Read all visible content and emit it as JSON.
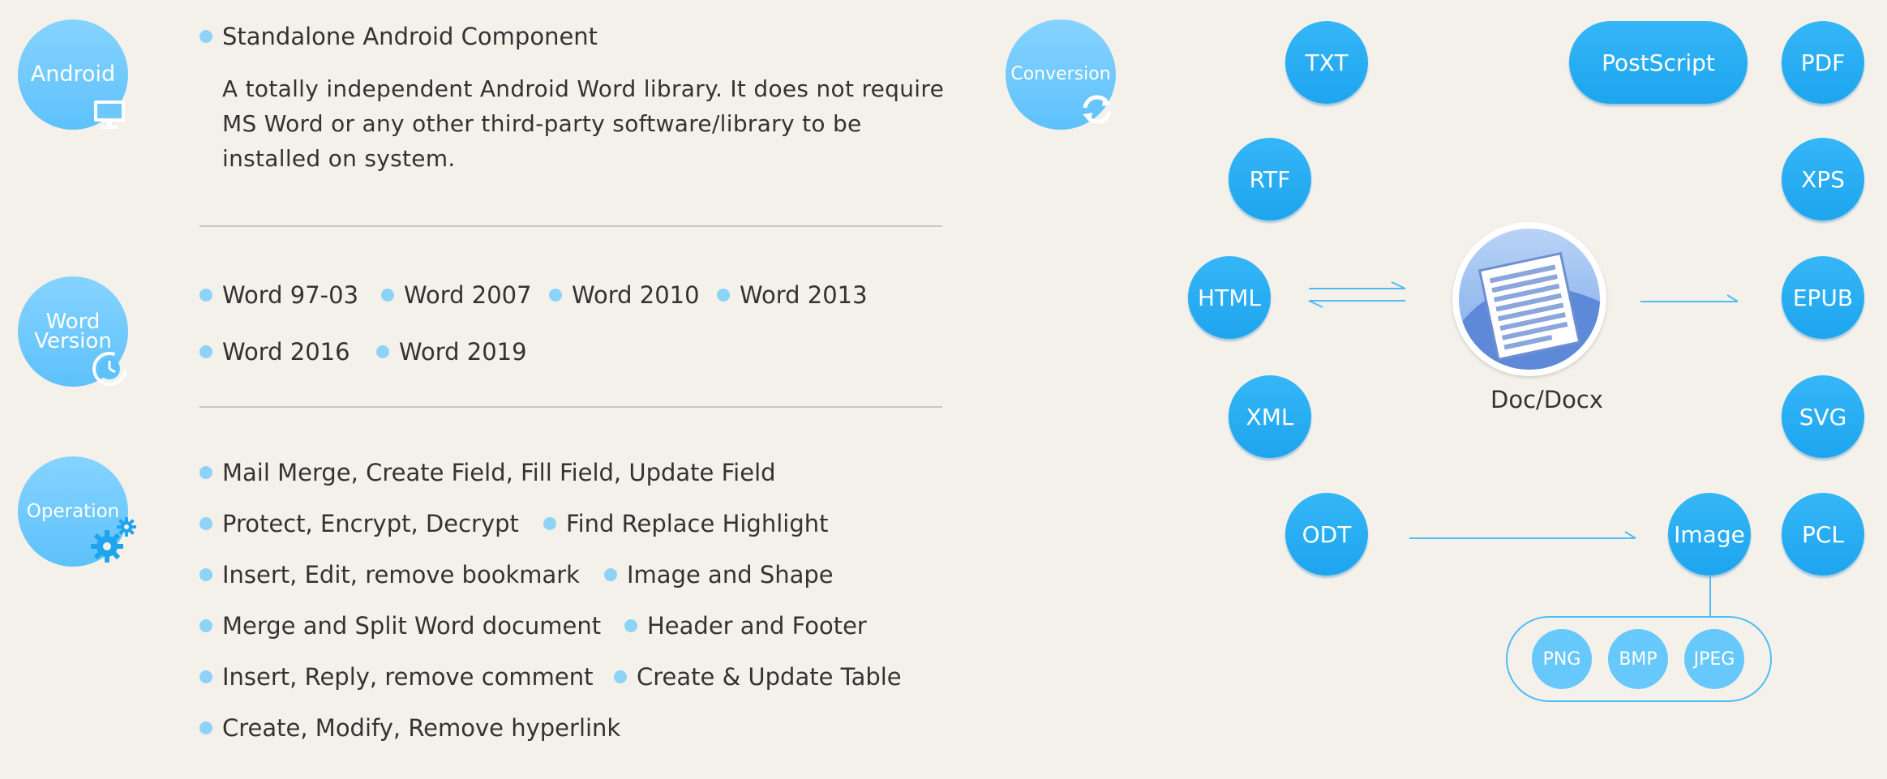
{
  "colors": {
    "background": "#f4f1eb",
    "badge": "#6ec8fc",
    "format_node": "#22a8ef",
    "bullet": "#8dd3f8",
    "arrow": "#4fbdf5",
    "text": "#333333"
  },
  "android": {
    "badge_label": "Android",
    "badge_icon": "monitor-icon",
    "title": "Standalone Android Component",
    "description": "A totally independent Android Word library. It does not require MS Word or any other third-party software/library to be installed on system."
  },
  "word_version": {
    "badge_label_line1": "Word",
    "badge_label_line2": "Version",
    "badge_icon": "clock-refresh-icon",
    "versions": [
      "Word 97-03",
      "Word 2007",
      "Word 2010",
      "Word 2013",
      "Word 2016",
      "Word 2019"
    ]
  },
  "operation": {
    "badge_label": "Operation",
    "badge_icon": "gears-icon",
    "items": [
      "Mail Merge, Create Field, Fill Field, Update Field",
      "Protect, Encrypt, Decrypt",
      "Find Replace Highlight",
      "Insert, Edit, remove bookmark",
      "Image and Shape",
      "Merge and Split Word document",
      "Header and Footer",
      "Insert, Reply, remove comment",
      "Create & Update Table",
      "Create, Modify, Remove hyperlink"
    ]
  },
  "conversion": {
    "badge_label": "Conversion",
    "badge_icon": "refresh-arrows-icon",
    "center_icon": "document-icon",
    "center_label": "Doc/Docx",
    "inputs": [
      "TXT",
      "RTF",
      "HTML",
      "XML",
      "ODT"
    ],
    "outputs": [
      "PostScript",
      "PDF",
      "XPS",
      "EPUB",
      "SVG",
      "PCL",
      "Image"
    ],
    "image_formats": [
      "PNG",
      "BMP",
      "JPEG"
    ]
  }
}
